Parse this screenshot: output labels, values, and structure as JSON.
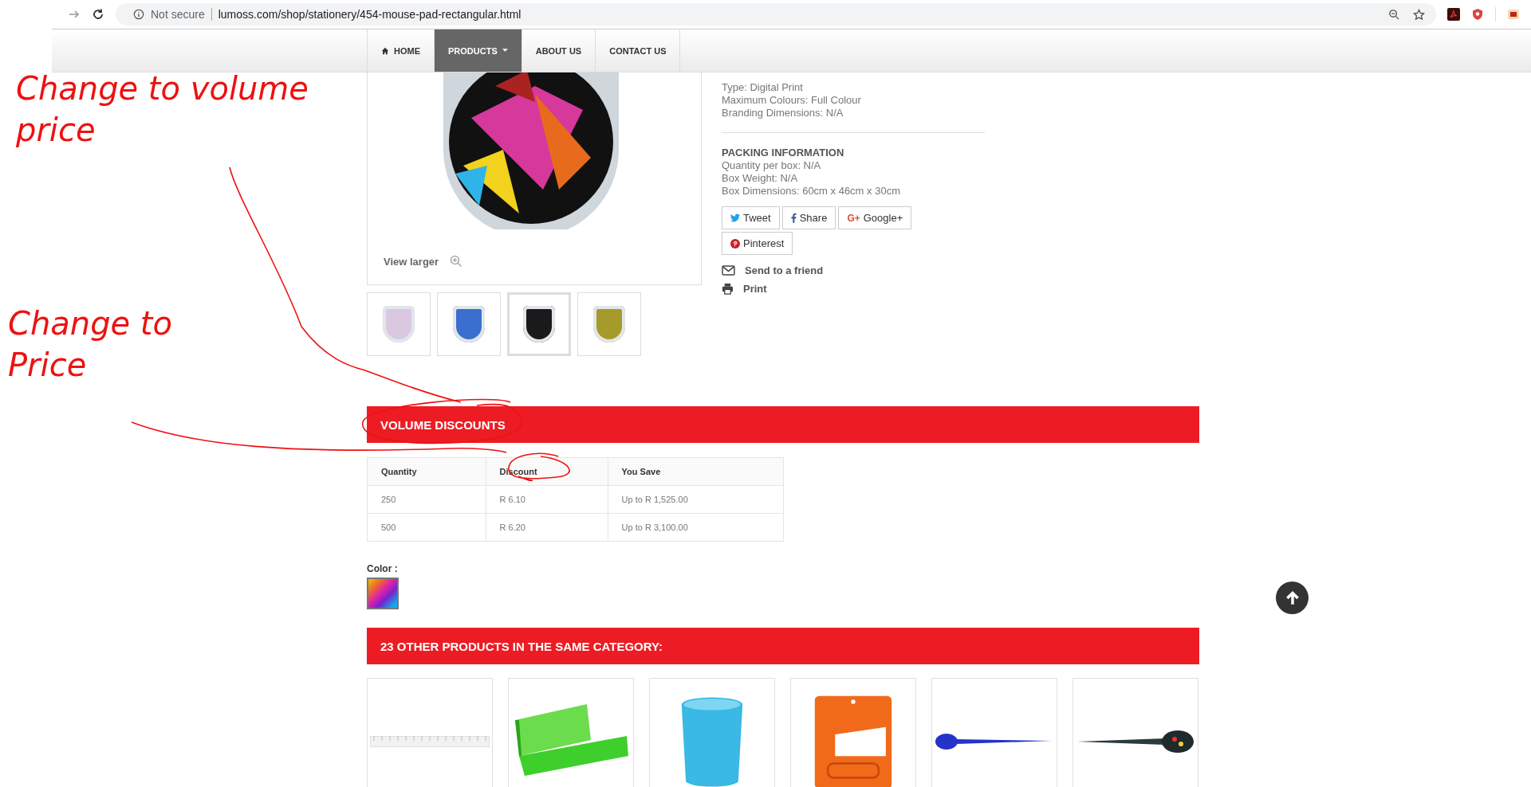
{
  "browser": {
    "security": "Not secure",
    "url": "lumoss.com/shop/stationery/454-mouse-pad-rectangular.html"
  },
  "nav": [
    {
      "kind": "home",
      "label": "HOME",
      "selected": false
    },
    {
      "kind": "dropdown",
      "label": "PRODUCTS",
      "selected": true
    },
    {
      "kind": "plain",
      "label": "ABOUT US",
      "selected": false
    },
    {
      "kind": "plain",
      "label": "CONTACT US",
      "selected": false
    }
  ],
  "product": {
    "view_larger": "View larger",
    "thumbnails": [
      {
        "color": "#d9c8e0",
        "selected": false
      },
      {
        "color": "#3a6fd0",
        "selected": false
      },
      {
        "color": "#1a1a1a",
        "selected": true
      },
      {
        "color": "#a69a2a",
        "selected": false
      }
    ]
  },
  "branding": [
    "Type: Digital Print",
    "Maximum Colours: Full Colour",
    "Branding Dimensions: N/A"
  ],
  "packing": {
    "title": "PACKING INFORMATION",
    "lines": [
      "Quantity per box: N/A",
      "Box Weight: N/A",
      "Box Dimensions: 60cm x 46cm x 30cm"
    ]
  },
  "share": [
    {
      "kind": "twitter",
      "label": "Tweet"
    },
    {
      "kind": "facebook",
      "label": "Share"
    },
    {
      "kind": "google",
      "icon_text": "G+",
      "label": "Google+"
    },
    {
      "kind": "pinterest",
      "label": "Pinterest"
    }
  ],
  "actions": [
    {
      "kind": "mail",
      "label": "Send to a friend"
    },
    {
      "kind": "print",
      "label": "Print"
    }
  ],
  "volume": {
    "title": "VOLUME DISCOUNTS",
    "columns": [
      "Quantity",
      "Discount",
      "You Save"
    ],
    "rows": [
      [
        "250",
        "R 6.10",
        "Up to R 1,525.00"
      ],
      [
        "500",
        "R 6.20",
        "Up to R 3,100.00"
      ]
    ]
  },
  "color": {
    "label": "Color :"
  },
  "related": {
    "title": "23 OTHER PRODUCTS IN THE SAME CATEGORY:",
    "products": [
      {
        "kind": "ruler"
      },
      {
        "kind": "pencil-case"
      },
      {
        "kind": "cup"
      },
      {
        "kind": "holder"
      },
      {
        "kind": "spoon-pen"
      },
      {
        "kind": "letter-opener"
      }
    ]
  },
  "annotations": [
    {
      "text": "Change to volume price"
    },
    {
      "text": "Change to Price"
    }
  ]
}
